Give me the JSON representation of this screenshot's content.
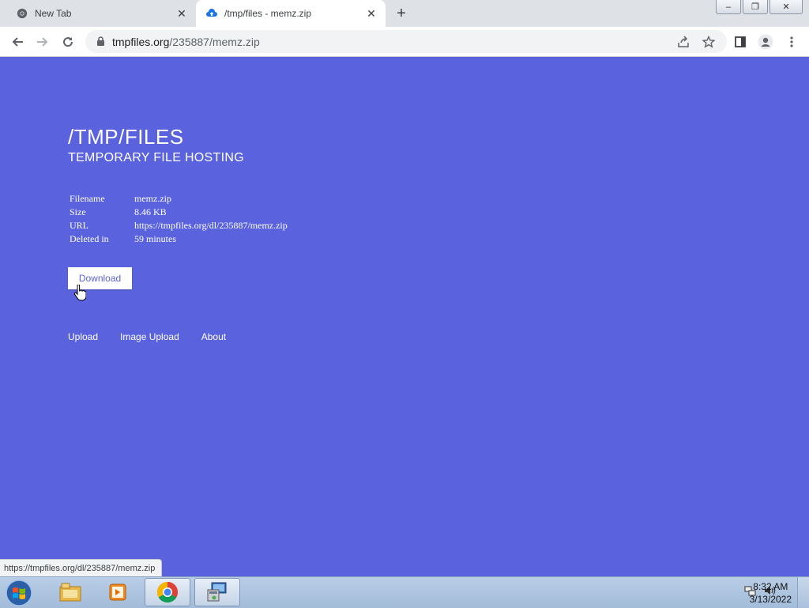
{
  "browser": {
    "tabs": [
      {
        "title": "New Tab",
        "icon": "chrome-icon"
      },
      {
        "title": "/tmp/files - memz.zip",
        "icon": "cloud-upload-icon",
        "active": true
      }
    ],
    "address": {
      "domain": "tmpfiles.org",
      "path": "/235887/memz.zip"
    },
    "status_url": "https://tmpfiles.org/dl/235887/memz.zip"
  },
  "page": {
    "title": "/TMP/FILES",
    "subtitle": "TEMPORARY FILE HOSTING",
    "info": [
      {
        "label": "Filename",
        "value": "memz.zip"
      },
      {
        "label": "Size",
        "value": "8.46 KB"
      },
      {
        "label": "URL",
        "value": "https://tmpfiles.org/dl/235887/memz.zip"
      },
      {
        "label": "Deleted in",
        "value": "59 minutes"
      }
    ],
    "download_label": "Download",
    "nav": [
      "Upload",
      "Image Upload",
      "About"
    ]
  },
  "taskbar": {
    "time": "8:32 AM",
    "date": "3/13/2022",
    "items": [
      "windows-explorer-icon",
      "media-player-icon",
      "chrome-icon",
      "network-setup-icon"
    ]
  },
  "colors": {
    "page_bg": "#5a63dd",
    "accent": "#1a73e8"
  }
}
